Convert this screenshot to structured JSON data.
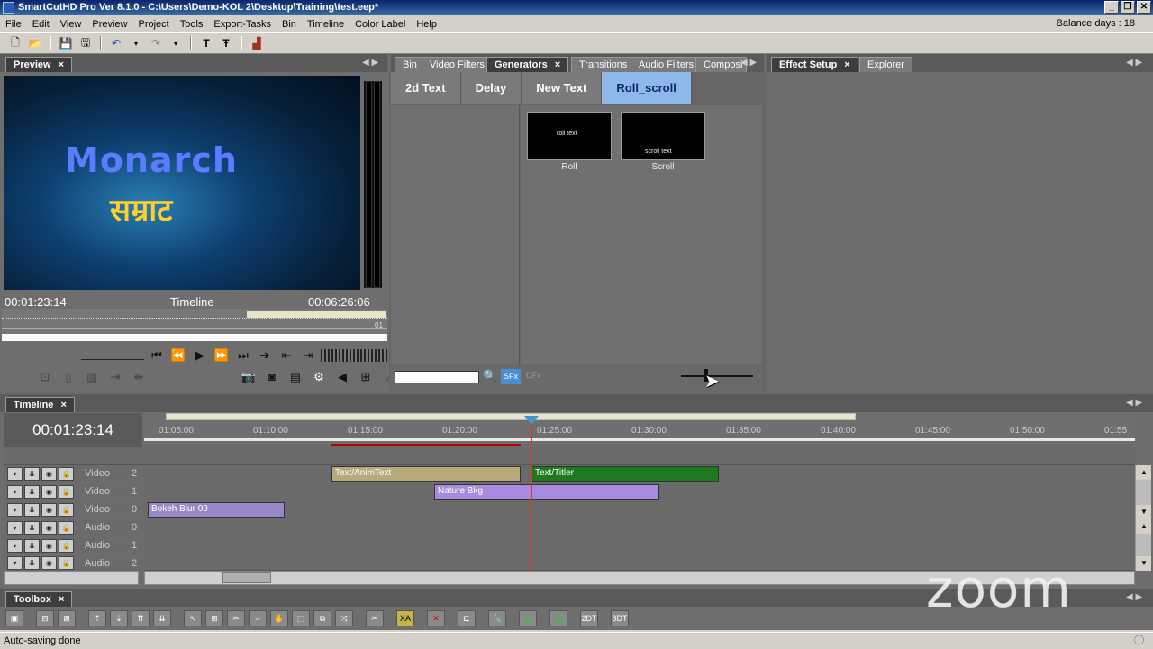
{
  "window": {
    "title": "SmartCutHD Pro Ver 8.1.0 - C:\\Users\\Demo-KOL 2\\Desktop\\Training\\test.eep*",
    "minimize": "_",
    "restore": "❐",
    "close": "✕"
  },
  "menu": {
    "items": [
      "File",
      "Edit",
      "View",
      "Preview",
      "Project",
      "Tools",
      "Export-Tasks",
      "Bin",
      "Timeline",
      "Color Label",
      "Help"
    ],
    "balance": "Balance days : 18"
  },
  "toolbar": {
    "icons": [
      "new-icon",
      "open-icon",
      "save-icon",
      "save-all-icon",
      "undo-icon",
      "redo-icon",
      "text-icon",
      "titler-icon",
      "export-icon"
    ]
  },
  "preview": {
    "tab_label": "Preview",
    "title_line1": "Monarch",
    "title_line2": "सम्राट",
    "timecode_left": "00:01:23:14",
    "mode_label": "Timeline",
    "timecode_right": "00:06:26:06",
    "scrub_marker": "01"
  },
  "library": {
    "tabs": [
      "Bin",
      "Video Filters",
      "Generators",
      "Transitions",
      "Audio Filters",
      "Composi"
    ],
    "active_tab": "Generators",
    "generator_buttons": [
      "2d Text",
      "Delay",
      "New Text",
      "Roll_scroll"
    ],
    "active_generator": "Roll_scroll",
    "thumbs": [
      {
        "label": "Roll",
        "overlay": "roll text"
      },
      {
        "label": "Scroll",
        "overlay": "scroll text"
      }
    ],
    "search_value": "",
    "sfx_label": "SFx",
    "dfx_label": "DFx"
  },
  "effect_panel": {
    "tabs": [
      "Effect Setup",
      "Explorer"
    ],
    "active_tab": "Effect Setup"
  },
  "timeline": {
    "tab_label": "Timeline",
    "current_time": "00:01:23:14",
    "ruler_labels": [
      "01:05:00",
      "01:10:00",
      "01:15:00",
      "01:20:00",
      "01:25:00",
      "01:30:00",
      "01:35:00",
      "01:40:00",
      "01:45:00",
      "01:50:00",
      "01:55"
    ],
    "tracks": [
      {
        "type": "Video",
        "num": "2"
      },
      {
        "type": "Video",
        "num": "1"
      },
      {
        "type": "Video",
        "num": "0"
      },
      {
        "type": "Audio",
        "num": "0"
      },
      {
        "type": "Audio",
        "num": "1"
      },
      {
        "type": "Audio",
        "num": "2"
      }
    ],
    "clips": {
      "anim_text": "Text/AnimText",
      "text_titler": "Text/Titler",
      "nature_bkg": "Nature Bkg",
      "bokeh_blur": "Bokeh Blur 09"
    },
    "clip_colors": {
      "anim_text": "#b7a97c",
      "text_titler": "#1f7a1f",
      "nature_bkg": "#a88ae0",
      "bokeh_blur": "#9a87c8"
    }
  },
  "toolbox": {
    "tab_label": "Toolbox",
    "labels_2dt": "2DT",
    "labels_3dt": "3DT"
  },
  "status": {
    "text": "Auto-saving done"
  },
  "overlay": {
    "zoom_logo": "zoom"
  }
}
